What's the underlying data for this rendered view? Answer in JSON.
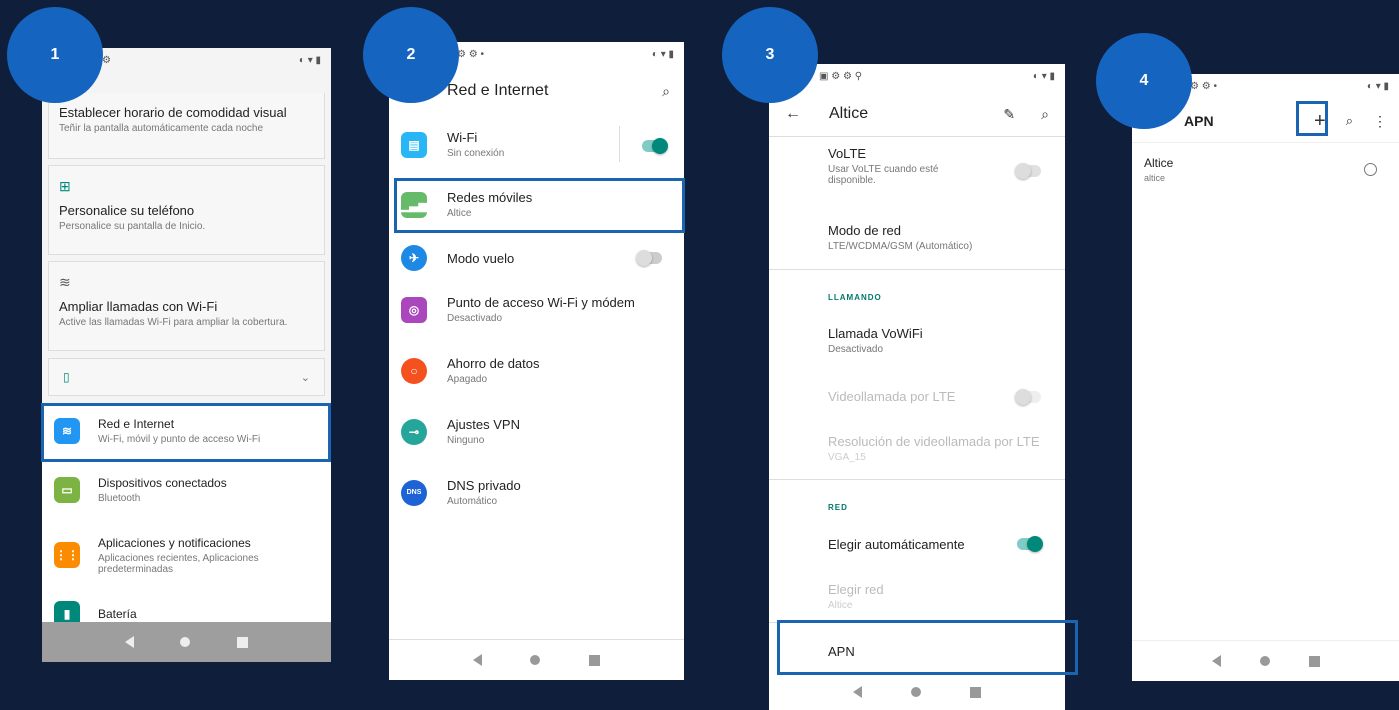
{
  "steps": [
    "1",
    "2",
    "3",
    "4"
  ],
  "phone1": {
    "items": [
      {
        "title": "Establecer horario de comodidad visual",
        "sub": "Teñir la pantalla automáticamente cada noche"
      },
      {
        "title": "Personalice su teléfono",
        "sub": "Personalice su pantalla de Inicio."
      },
      {
        "title": "Ampliar llamadas con Wi-Fi",
        "sub": "Active las llamadas Wi-Fi para ampliar la cobertura."
      }
    ],
    "settings": [
      {
        "title": "Red e Internet",
        "sub": "Wi-Fi, móvil y punto de acceso Wi-Fi",
        "color": "#2196f3"
      },
      {
        "title": "Dispositivos conectados",
        "sub": "Bluetooth",
        "color": "#7cb342"
      },
      {
        "title": "Aplicaciones y notificaciones",
        "sub": "Aplicaciones recientes, Aplicaciones predeterminadas",
        "color": "#fb8c00"
      },
      {
        "title": "Batería",
        "sub": "",
        "color": "#00897b"
      }
    ]
  },
  "phone2": {
    "title": "Red e Internet",
    "items": [
      {
        "title": "Wi-Fi",
        "sub": "Sin conexión",
        "color": "#29b6f6"
      },
      {
        "title": "Redes móviles",
        "sub": "Altice",
        "color": "#66bb6a"
      },
      {
        "title": "Modo vuelo",
        "sub": "",
        "color": "#1e88e5"
      },
      {
        "title": "Punto de acceso Wi-Fi y módem",
        "sub": "Desactivado",
        "color": "#ab47bc"
      },
      {
        "title": "Ahorro de datos",
        "sub": "Apagado",
        "color": "#f4511e"
      },
      {
        "title": "Ajustes VPN",
        "sub": "Ninguno",
        "color": "#26a69a"
      },
      {
        "title": "DNS privado",
        "sub": "Automático",
        "color": "#1e63d6",
        "icon": "DNS"
      }
    ]
  },
  "phone3": {
    "title": "Altice",
    "volte": {
      "title": "VoLTE",
      "sub": "Usar VoLTE cuando esté disponible."
    },
    "modo_red": {
      "title": "Modo de red",
      "sub": "LTE/WCDMA/GSM (Automático)"
    },
    "section_llamando": "LLAMANDO",
    "vowifi": {
      "title": "Llamada VoWiFi",
      "sub": "Desactivado"
    },
    "video_lte": "Videollamada por LTE",
    "resolucion": {
      "title": "Resolución de videollamada por LTE",
      "sub": "VGA_15"
    },
    "section_red": "RED",
    "auto": "Elegir automáticamente",
    "elegir_red": {
      "title": "Elegir red",
      "sub": "Altice"
    },
    "apn": "APN"
  },
  "phone4": {
    "title": "APN",
    "item": {
      "title": "Altice",
      "sub": "altice"
    }
  }
}
